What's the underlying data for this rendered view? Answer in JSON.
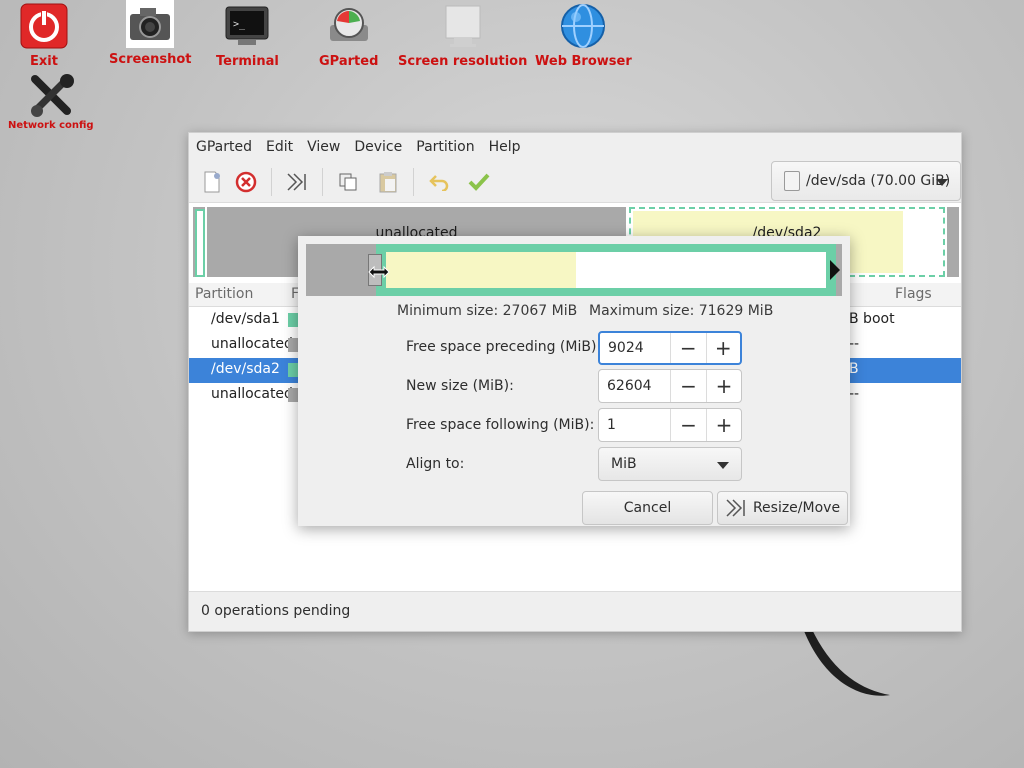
{
  "desktop": {
    "icons": [
      {
        "label": "Exit"
      },
      {
        "label": "Screenshot"
      },
      {
        "label": "Terminal"
      },
      {
        "label": "GParted"
      },
      {
        "label": "Screen resolution"
      },
      {
        "label": "Web Browser"
      },
      {
        "label": "Network config"
      }
    ]
  },
  "window": {
    "menu": [
      "GParted",
      "Edit",
      "View",
      "Device",
      "Partition",
      "Help"
    ],
    "device_selector": "/dev/sda (70.00 GiB)",
    "strip": {
      "unallocated_label": "unallocated",
      "sda2_label": "/dev/sda2"
    },
    "columns": {
      "partition": "Partition",
      "fs_partial": "F",
      "flags": "Flags"
    },
    "rows": [
      {
        "name": "/dev/sda1",
        "flag": "B  boot",
        "color": "#6ccfa7"
      },
      {
        "name": "unallocated",
        "flag": "--",
        "color": "#a9a9a9"
      },
      {
        "name": "/dev/sda2",
        "flag": "B",
        "color": "#6ccfa7"
      },
      {
        "name": "unallocated",
        "flag": "--",
        "color": "#a9a9a9"
      }
    ],
    "status": "0 operations pending"
  },
  "dialog": {
    "min_size": "Minimum size: 27067 MiB",
    "max_size": "Maximum size: 71629 MiB",
    "fields": {
      "preceding_label": "Free space preceding (MiB):",
      "preceding_value": "9024",
      "newsize_label": "New size (MiB):",
      "newsize_value": "62604",
      "following_label": "Free space following (MiB):",
      "following_value": "1",
      "align_label": "Align to:",
      "align_value": "MiB"
    },
    "cancel_label": "Cancel",
    "resize_label": "Resize/Move"
  }
}
